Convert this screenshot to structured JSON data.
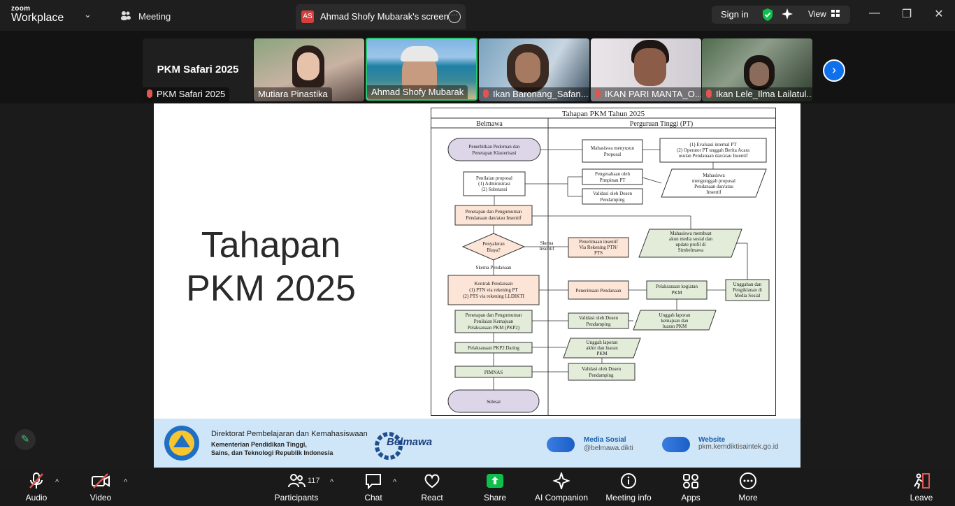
{
  "app": {
    "logo_top": "zoom",
    "logo_bottom": "Workplace",
    "meeting_label": "Meeting"
  },
  "share": {
    "badge": "AS",
    "label": "Ahmad Shofy Mubarak's screen"
  },
  "topright": {
    "signin": "Sign in",
    "view": "View"
  },
  "participants_strip": {
    "host_title": "PKM Safari 2025",
    "host_name": "PKM Safari 2025",
    "thumbs": [
      {
        "name": "Mutiara Pinastika",
        "muted": false
      },
      {
        "name": "Ahmad Shofy Mubarak",
        "muted": false,
        "active": true
      },
      {
        "name": "Ikan Baronang_Safan...",
        "muted": true
      },
      {
        "name": "IKAN PARI MANTA_O...",
        "muted": true
      },
      {
        "name": "Ikan Lele_Ilma Lailatul...",
        "muted": true
      }
    ]
  },
  "slide": {
    "title_line1": "Tahapan",
    "title_line2": "PKM 2025",
    "flow": {
      "heading": "Tahapan PKM Tahun 2025",
      "col_left": "Belmawa",
      "col_right": "Perguruan Tinggi (PT)",
      "n1a": "Penerbitkan Pedoman dan",
      "n1b": "Penetapan Klasterisasi",
      "n2a": "Mahasiswa menyusun",
      "n2b": "Proposal",
      "n3a": "(1) Evaluasi internal PT",
      "n3b": "(2) Operator PT unggah Berita Acara",
      "n3c": "usulan Pendanaan dan/atau Insentif",
      "n4a": "Penilaian proposal",
      "n4b": "(1) Administrasi",
      "n4c": "(2) Substansi",
      "n5a": "Pengesahaan oleh",
      "n5b": "Pimpinan PT",
      "n6a": "Mahasiswa",
      "n6b": "mengunggah proposal",
      "n6c": "Pendanaan dan/atau",
      "n6d": "Insentif",
      "n7a": "Validasi oleh Dosen",
      "n7b": "Pendamping",
      "n8a": "Penetapan dan Pengumuman",
      "n8b": "Pendanaan dan/atau Insentif",
      "n9a": "Penyaluran",
      "n9b": "Biaya?",
      "n10a": "Skema",
      "n10b": "Insentif",
      "n11a": "Penerimaan insentif",
      "n11b": "Via Rekening PTN/",
      "n11c": "PTS",
      "n12a": "Mahasiswa membuat",
      "n12b": "akun media sosial dan",
      "n12c": "update profil di",
      "n12d": "Simbelmawa",
      "n13": "Skema Pendanaan",
      "n14a": "Kontrak Pendanaan",
      "n14b": "(1) PTN via rekening PT",
      "n14c": "(2) PTS via rekening LLDIKTI",
      "n15": "Penerimaan Pendanaan",
      "n16a": "Pelaksanaan kegiatan",
      "n16b": "PKM",
      "n17a": "Unggahan dan",
      "n17b": "Pengiklanan di",
      "n17c": "Media Sosial",
      "n18a": "Penetapan dan Pengumuman",
      "n18b": "Penilaian Kemajuan",
      "n18c": "Pelaksanaan PKM (PKP2)",
      "n19a": "Validasi oleh Dosen",
      "n19b": "Pendamping",
      "n20a": "Unggah laporan",
      "n20b": "kemajuan dan",
      "n20c": "luaran PKM",
      "n21": "Pelaksanaan PKP2 Daring",
      "n22a": "Unggah laporan",
      "n22b": "akhir dan luaran",
      "n22c": "PKM",
      "n23": "PIMNAS",
      "n24a": "Validasi oleh Dosen",
      "n24b": "Pendamping",
      "n25": "Selesai"
    },
    "footer": {
      "dit1": "Direktorat Pembelajaran dan Kemahasiswaan",
      "dit2": "Kementerian Pendidikan Tinggi,",
      "dit3": "Sains, dan Teknologi Republik Indonesia",
      "belmawa": "Belmawa",
      "ms_title": "Media Sosial",
      "ms_val": "@belmawa.dikti",
      "ws_title": "Website",
      "ws_val": "pkm.kemdiktisaintek.go.id"
    }
  },
  "toolbar": {
    "audio": "Audio",
    "video": "Video",
    "participants": "Participants",
    "participants_count": "117",
    "chat": "Chat",
    "react": "React",
    "share": "Share",
    "ai": "AI Companion",
    "info": "Meeting info",
    "apps": "Apps",
    "more": "More",
    "leave": "Leave"
  },
  "colors": {
    "accent": "#0e71eb",
    "share_green": "#0fbf4c",
    "mute_red": "#e0554f",
    "active_border": "#28c76f"
  }
}
